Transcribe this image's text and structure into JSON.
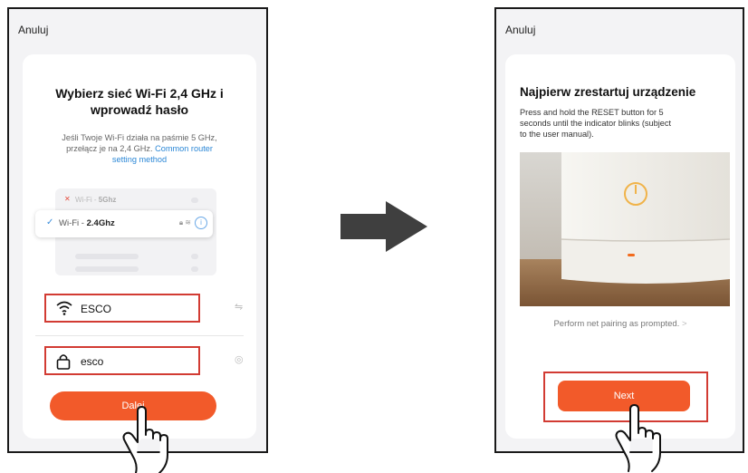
{
  "left_screen": {
    "cancel_label": "Anuluj",
    "title_line1": "Wybierz sieć Wi-Fi 2,4 GHz i",
    "title_line2": "wprowadź hasło",
    "desc_line1": "Jeśli Twoje Wi-Fi działa na paśmie 5 GHz,",
    "desc_line2_prefix": "przełącz je na 2,4 GHz. ",
    "desc_link_part1": "Common router",
    "desc_link_part2": "setting method",
    "wifi_5g_prefix": "Wi-Fi - ",
    "wifi_5g_band": "5Ghz",
    "wifi_24g_prefix": "Wi-Fi - ",
    "wifi_24g_band": "2.4Ghz",
    "ssid_value": "ESCO",
    "password_value": "esco",
    "next_label": "Dalej"
  },
  "right_screen": {
    "cancel_label": "Anuluj",
    "title": "Najpierw zrestartuj urządzenie",
    "desc_line1": "Press and hold the RESET button for 5",
    "desc_line2": "seconds until the indicator blinks (subject",
    "desc_line3": "to the user manual).",
    "hint": "Perform net pairing as prompted.",
    "hint_chevron": ">",
    "next_label": "Next"
  },
  "colors": {
    "accent": "#f25a2a",
    "highlight_frame": "#d23b33",
    "link": "#2b87d6"
  }
}
